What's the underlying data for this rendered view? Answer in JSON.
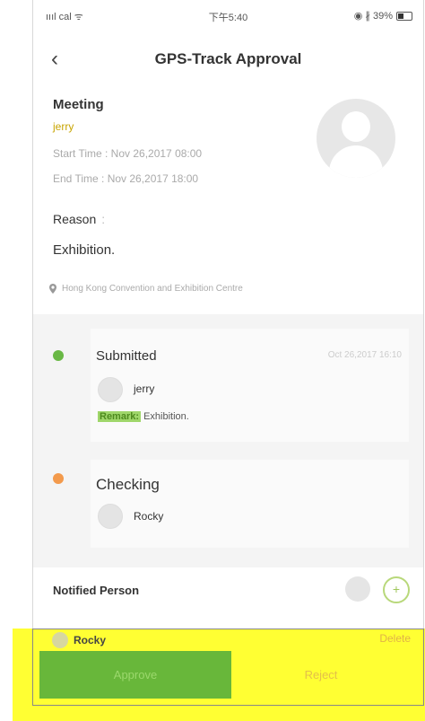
{
  "status_bar": {
    "carrier": "ıııl cal ᯤ",
    "time": "下午5:40",
    "battery_text": "◉ ∦ 39%"
  },
  "header": {
    "back_icon": "‹",
    "title": "GPS-Track Approval"
  },
  "meeting": {
    "type": "Meeting",
    "user": "jerry",
    "start_time": "Start Time : Nov 26,2017 08:00",
    "end_time": "End Time : Nov 26,2017 18:00"
  },
  "reason": {
    "label": "Reason",
    "text": "Exhibition."
  },
  "location": {
    "icon": "pin-icon",
    "text": "Hong Kong Convention and Exhibition Centre"
  },
  "timeline": [
    {
      "status": "Submitted",
      "time": "Oct 26,2017 16:10",
      "person": "jerry",
      "remark_label": "Remark:",
      "remark_text": "Exhibition."
    },
    {
      "status": "Checking",
      "person": "Rocky"
    }
  ],
  "notified": {
    "label": "Notified Person",
    "add_icon": "+",
    "person": "Rocky",
    "delete_label": "Delete"
  },
  "actions": {
    "approve": "Approve",
    "reject": "Reject"
  },
  "colors": {
    "accent_green": "#68b73a",
    "highlight_yellow": "#ffff33",
    "status_orange": "#f39a4c"
  }
}
